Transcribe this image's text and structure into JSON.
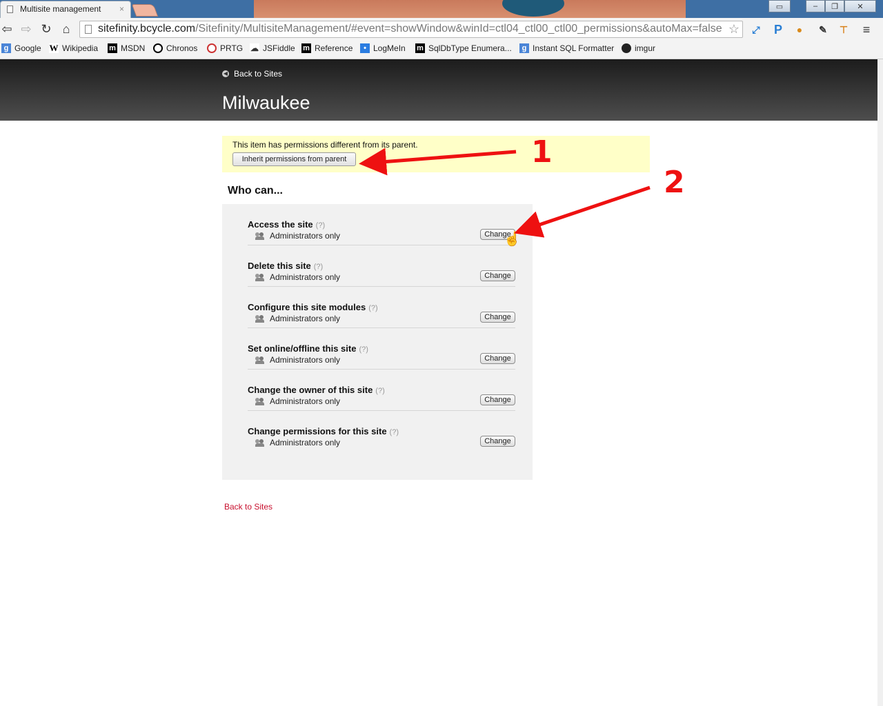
{
  "browser": {
    "tab_title": "Multisite management",
    "tab_close": "×",
    "url_host": "sitefinity.bcycle.com",
    "url_path": "/Sitefinity/MultisiteManagement/#event=showWindow&winId=ctl04_ctl00_ctl00_permissions&autoMax=false",
    "bookmarks": [
      {
        "label": "Google",
        "icon": "google-icon"
      },
      {
        "label": "Wikipedia",
        "icon": "wikipedia-icon"
      },
      {
        "label": "MSDN",
        "icon": "msdn-icon"
      },
      {
        "label": "Chronos",
        "icon": "chronos-icon"
      },
      {
        "label": "PRTG",
        "icon": "prtg-icon"
      },
      {
        "label": "JSFiddle",
        "icon": "jsfiddle-icon"
      },
      {
        "label": "Reference",
        "icon": "reference-icon"
      },
      {
        "label": "LogMeIn",
        "icon": "logmein-icon"
      },
      {
        "label": "SqlDbType Enumera...",
        "icon": "msdn-icon"
      },
      {
        "label": "Instant SQL Formatter",
        "icon": "google-icon"
      },
      {
        "label": "imgur",
        "icon": "imgur-icon"
      }
    ]
  },
  "page": {
    "back_to_sites_top": "Back to Sites",
    "site_name": "Milwaukee",
    "notice": {
      "message": "This item has permissions different from its parent.",
      "inherit_button": "Inherit permissions from parent"
    },
    "who_can": "Who can...",
    "help_marker": "(?)",
    "permissions": [
      {
        "label": "Access the site",
        "who": "Administrators only",
        "button": "Change"
      },
      {
        "label": "Delete this site",
        "who": "Administrators only",
        "button": "Change"
      },
      {
        "label": "Configure this site modules",
        "who": "Administrators only",
        "button": "Change"
      },
      {
        "label": "Set online/offline this site",
        "who": "Administrators only",
        "button": "Change"
      },
      {
        "label": "Change the owner of this site",
        "who": "Administrators only",
        "button": "Change"
      },
      {
        "label": "Change permissions for this site",
        "who": "Administrators only",
        "button": "Change"
      }
    ],
    "back_to_sites_bottom": "Back to Sites"
  },
  "annotations": {
    "one": "1",
    "two": "2"
  },
  "colors": {
    "annotation": "#ee1111",
    "link_red": "#c8102e",
    "notice_bg": "#ffffc8",
    "header_dark": "#2a2a2a"
  }
}
